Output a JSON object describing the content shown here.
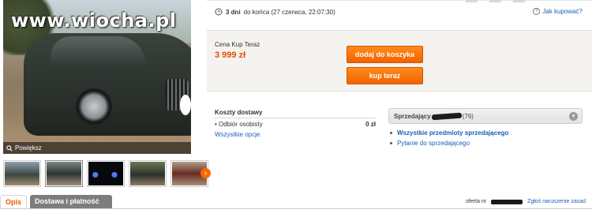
{
  "watermark": "www.wiocha.pl",
  "photo": {
    "enlarge_label": "Powiększ"
  },
  "time": {
    "days": "3 dni",
    "rest": "do końca (27 czerwca, 22:07:30)"
  },
  "help": {
    "label": "Jak kupować?"
  },
  "price": {
    "label": "Cena Kup Teraz",
    "value": "3 999 zł"
  },
  "buttons": {
    "add_to_cart": "dodaj do koszyka",
    "buy_now": "kup teraz"
  },
  "shipping": {
    "title": "Koszty dostawy",
    "option": "Odbiór osobisty",
    "cost": "0 zł",
    "more_link": "Wszystkie opcje"
  },
  "seller": {
    "label": "Sprzedający",
    "rating": "(76)",
    "links": [
      "Wszystkie przedmioty sprzedającego",
      "Pytanie do sprzedającego"
    ]
  },
  "tabs": {
    "description": "Opis",
    "shipping_payment": "Dostawa i płatność"
  },
  "footer": {
    "offer_prefix": "oferta nr",
    "report": "Zgłoś naruszenie zasad"
  },
  "colors": {
    "accent_orange": "#ff6600",
    "price_red": "#e04e00",
    "link_blue": "#1a5fb4"
  }
}
